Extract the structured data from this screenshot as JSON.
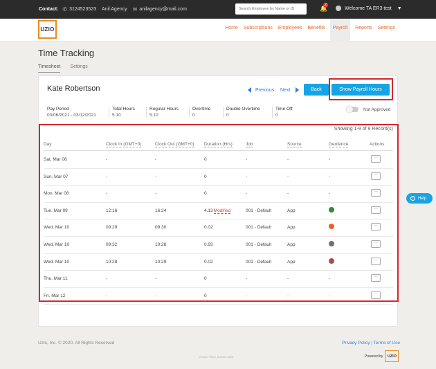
{
  "topbar": {
    "contact_label": "Contact:",
    "phone": "3124523523",
    "agency": "Anil Agency",
    "email": "anilagency@mail.com",
    "search_placeholder": "Search Employee by Name or ID",
    "notification_count": "2",
    "welcome": "Welcome TA ER3 test"
  },
  "logo": "UZIO",
  "nav": [
    "Home",
    "Subscriptions",
    "Employees",
    "Benefits",
    "Payroll",
    "Reports",
    "Settings"
  ],
  "page_title": "Time Tracking",
  "subtabs": [
    "Timesheet",
    "Settings"
  ],
  "employee_name": "Kate Robertson",
  "pager": {
    "previous": "Previous",
    "next": "Next"
  },
  "buttons": {
    "back": "Back",
    "show_payroll_hours": "Show Payroll Hours"
  },
  "summary": [
    {
      "label": "Pay Period",
      "value": "03/06/2021 - 03/12/2021"
    },
    {
      "label": "Total Hours",
      "value": "5.10"
    },
    {
      "label": "Regular Hours",
      "value": "5.10"
    },
    {
      "label": "Overtime",
      "value": "0"
    },
    {
      "label": "Double Overtime",
      "value": "0"
    },
    {
      "label": "Time Off",
      "value": "0"
    }
  ],
  "approval_label": "Not Approved",
  "records_label": "Showing 1-9 of 9 Record(s)",
  "columns": [
    "Day",
    "Clock In (GMT+0)",
    "Clock Out (GMT+0)",
    "Duration (Hrs)",
    "Job",
    "Source",
    "Geofence",
    "Actions"
  ],
  "rows": [
    {
      "day": "Sat. Mar 06",
      "in": "-",
      "out": "-",
      "duration": "0",
      "modified": "",
      "job": "-",
      "source": "-",
      "geofence": "-"
    },
    {
      "day": "Sun. Mar 07",
      "in": "-",
      "out": "-",
      "duration": "0",
      "modified": "",
      "job": "-",
      "source": "-",
      "geofence": "-"
    },
    {
      "day": "Mon. Mar 08",
      "in": "-",
      "out": "-",
      "duration": "0",
      "modified": "",
      "job": "-",
      "source": "-",
      "geofence": "-"
    },
    {
      "day": "Tue. Mar 09",
      "in": "12:16",
      "out": "16:24",
      "duration": "4.13",
      "modified": "Modified",
      "job": "001 - Default",
      "source": "App",
      "geofence": "globe-green"
    },
    {
      "day": "Wed. Mar 10",
      "in": "09:29",
      "out": "09:30",
      "duration": "0.02",
      "modified": "",
      "job": "001 - Default",
      "source": "App",
      "geofence": "globe-orange"
    },
    {
      "day": "Wed. Mar 10",
      "in": "09:32",
      "out": "10:28",
      "duration": "0.93",
      "modified": "",
      "job": "001 - Default",
      "source": "App",
      "geofence": "globe-gray"
    },
    {
      "day": "Wed. Mar 10",
      "in": "10:28",
      "out": "10:29",
      "duration": "0.02",
      "modified": "",
      "job": "001 - Default",
      "source": "App",
      "geofence": "globe-brown"
    },
    {
      "day": "Thu. Mar 11",
      "in": "-",
      "out": "-",
      "duration": "0",
      "modified": "",
      "job": "-",
      "source": "-",
      "geofence": "-"
    },
    {
      "day": "Fri. Mar 12",
      "in": "-",
      "out": "-",
      "duration": "0",
      "modified": "",
      "job": "-",
      "source": "-",
      "geofence": "-"
    }
  ],
  "actions_glyph": "···",
  "help_label": "Help",
  "footer": {
    "copyright": "Uzio, Inc. © 2020. All Rights Reserved",
    "privacy": "Privacy Policy",
    "terms": "Terms of Use",
    "version": "Version: PHIX_B-0007-0328",
    "powered_by": "Powered by"
  },
  "colors": {
    "accent": "#15a4e4",
    "brand": "#f08a1c",
    "nav": "#e06a2b",
    "highlight": "#d9262c"
  }
}
